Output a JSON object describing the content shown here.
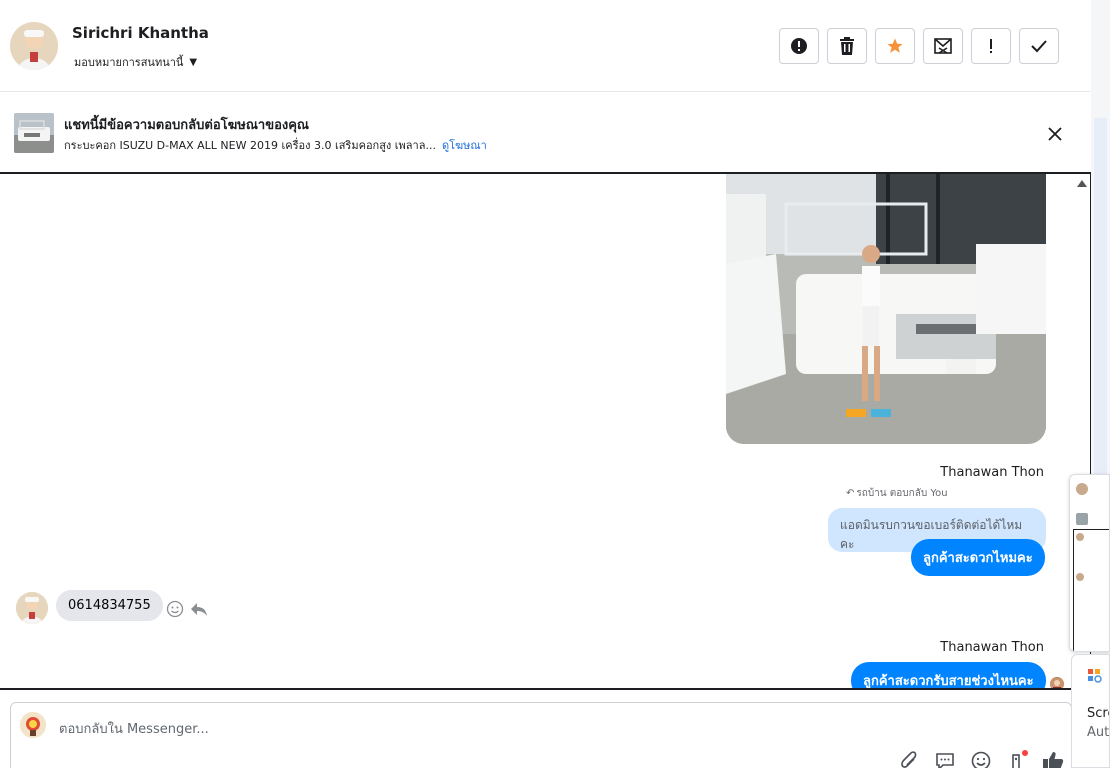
{
  "header": {
    "name": "Sirichri Khantha",
    "assign_label": "มอบหมายการสนทนานี้",
    "action_icons": [
      "alert-circle-icon",
      "trash-icon",
      "star-icon",
      "mail-x-icon",
      "exclamation-icon",
      "checkmark-icon"
    ],
    "star_color": "#f7923b"
  },
  "ad_banner": {
    "title": "แชทนี้มีข้อความตอบกลับต่อโฆษณาของคุณ",
    "description": "กระบะคอก ISUZU D-MAX ALL NEW 2019 เครื่อง 3.0 เสริมคอกสูง เพลาล...",
    "link_label": "ดูโฆษณา"
  },
  "thread": {
    "messages": [
      {
        "sender": "Thanawan Thon",
        "reply_note": "รถบ้าน ตอบกลับ You",
        "quoted": "แอดมินรบกวนขอเบอร์ติดต่อได้ไหมคะ",
        "text": "ลูกค้าสะดวกไหมคะ"
      },
      {
        "incoming": true,
        "text": "0614834755"
      },
      {
        "sender": "Thanawan Thon",
        "text": "ลูกค้าสะดวกรับสายช่วงไหนคะ"
      }
    ]
  },
  "composer": {
    "placeholder": "ตอบกลับใน Messenger...",
    "tool_icons": [
      "paperclip-icon",
      "saved-reply-icon",
      "emoji-icon",
      "tag-icon",
      "thumbs-up-icon"
    ]
  },
  "side_card": {
    "line1": "Scre",
    "line2": "Auto"
  },
  "colors": {
    "accent": "#0084ff",
    "link": "#216fdb",
    "quoted_bg": "#cce4ff"
  }
}
